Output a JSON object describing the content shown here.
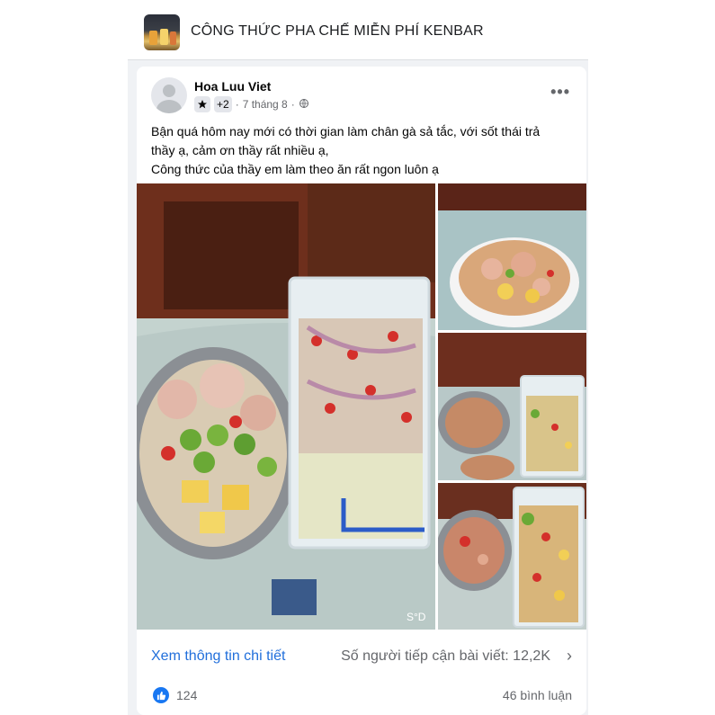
{
  "group": {
    "name": "CÔNG THỨC PHA CHẾ MIỄN PHÍ KENBAR"
  },
  "post": {
    "author": "Hoa Luu Viet",
    "badge_extra": "+2",
    "time": "7 tháng 8",
    "separator": "·",
    "more_label": "•••",
    "text_lines": [
      "Bận quá hôm nay mới có thời gian làm chân gà sả tắc, với sốt thái trả",
      "thầy ạ, cảm ơn thầy rất nhiều ạ,",
      "Công thức của thầy em làm theo ăn rất ngon luôn ạ"
    ],
    "watermark": "S°D"
  },
  "footer": {
    "detail_link": "Xem thông tin chi tiết",
    "reach": "Số người tiếp cận bài viết: 12,2K",
    "chevron": "›",
    "likes": "124",
    "comments": "46 bình luận"
  },
  "icons": {
    "star": "star-icon",
    "globe": "globe-icon",
    "like": "like-icon",
    "more": "more-icon",
    "chevron": "chevron-right-icon"
  },
  "colors": {
    "link": "#216fdb",
    "like": "#1877f2",
    "muted": "#65676b"
  }
}
